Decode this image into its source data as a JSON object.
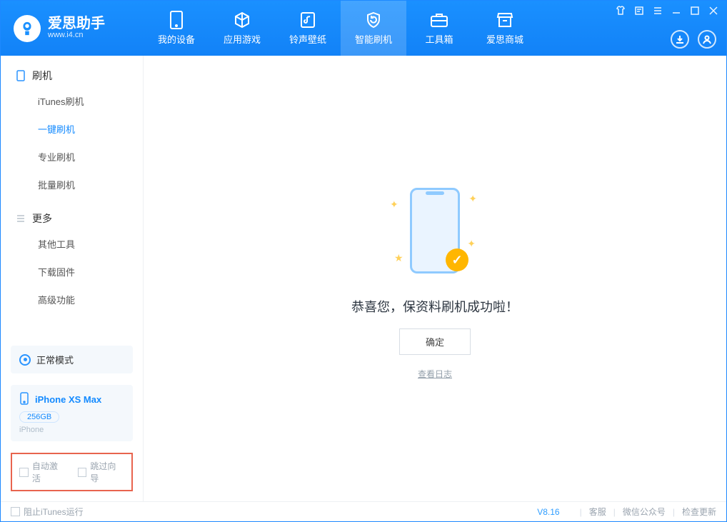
{
  "brand": {
    "name_cn": "爱思助手",
    "name_en": "www.i4.cn"
  },
  "nav": {
    "items": [
      {
        "label": "我的设备"
      },
      {
        "label": "应用游戏"
      },
      {
        "label": "铃声壁纸"
      },
      {
        "label": "智能刷机"
      },
      {
        "label": "工具箱"
      },
      {
        "label": "爱思商城"
      }
    ]
  },
  "sidebar": {
    "flash_head": "刷机",
    "flash_items": [
      "iTunes刷机",
      "一键刷机",
      "专业刷机",
      "批量刷机"
    ],
    "more_head": "更多",
    "more_items": [
      "其他工具",
      "下载固件",
      "高级功能"
    ]
  },
  "mode": {
    "label": "正常模式"
  },
  "device": {
    "name": "iPhone XS Max",
    "capacity": "256GB",
    "platform": "iPhone"
  },
  "options": {
    "auto_activate": "自动激活",
    "skip_guide": "跳过向导"
  },
  "main": {
    "success_msg": "恭喜您，保资料刷机成功啦！",
    "ok_btn": "确定",
    "view_log": "查看日志"
  },
  "footer": {
    "block_itunes": "阻止iTunes运行",
    "version": "V8.16",
    "support": "客服",
    "wechat": "微信公众号",
    "update": "检查更新"
  }
}
